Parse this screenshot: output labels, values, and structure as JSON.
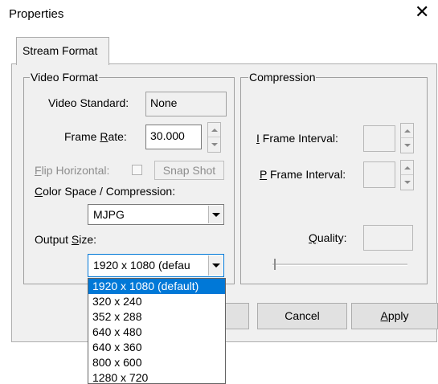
{
  "window": {
    "title": "Properties",
    "close_glyph": "✕"
  },
  "tabs": [
    {
      "label": "Stream Format",
      "selected": true
    }
  ],
  "video_format": {
    "group_label": "Video Format",
    "video_standard": {
      "label": "Video Standard:",
      "value": "None"
    },
    "frame_rate": {
      "label_prefix": "Frame ",
      "label_accel": "R",
      "label_suffix": "ate:",
      "value": "30.000"
    },
    "flip_horizontal": {
      "label_accel": "F",
      "label_rest": "lip Horizontal:",
      "checked": false
    },
    "snap_shot_label": "Snap Shot",
    "color_space": {
      "label_accel": "C",
      "label_rest": "olor Space / Compression:",
      "selected": "MJPG"
    },
    "output_size": {
      "label_prefix": "Output ",
      "label_accel": "S",
      "label_suffix": "ize:",
      "selected": "1920 x 1080  (defau",
      "options": [
        "1920 x 1080  (default)",
        "320 x 240",
        "352 x 288",
        "640 x 480",
        "640 x 360",
        "800 x 600",
        "1280 x 720"
      ],
      "highlighted_option": "1920 x 1080  (default)"
    }
  },
  "compression": {
    "group_label": "Compression",
    "i_frame": {
      "label_accel": "I",
      "label_rest": " Frame Interval:"
    },
    "p_frame": {
      "label_accel": "P",
      "label_rest": " Frame Interval:"
    },
    "quality": {
      "label_accel": "Q",
      "label_rest": "uality:"
    }
  },
  "buttons": {
    "cancel": "Cancel",
    "apply_accel": "A",
    "apply_rest": "pply"
  },
  "colors": {
    "selection": "#0078d7",
    "dialog_bg": "#f0f0f0"
  },
  "icons": {
    "close": "close-icon",
    "combo_arrow": "chevron-down-icon",
    "spin": "spin-arrows-icon"
  }
}
